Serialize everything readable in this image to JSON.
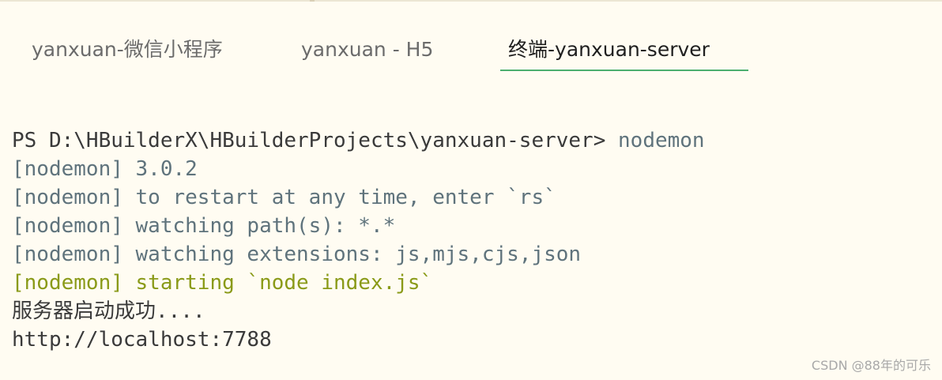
{
  "tabs": [
    {
      "label": "yanxuan-微信小程序",
      "active": false
    },
    {
      "label": "yanxuan - H5",
      "active": false
    },
    {
      "label": "终端-yanxuan-server",
      "active": true
    }
  ],
  "terminal": {
    "prompt": "PS D:\\HBuilderX\\HBuilderProjects\\yanxuan-server> ",
    "command": "nodemon",
    "lines": [
      "[nodemon] 3.0.2",
      "[nodemon] to restart at any time, enter `rs`",
      "[nodemon] watching path(s): *.*",
      "[nodemon] watching extensions: js,mjs,cjs,json",
      "[nodemon] starting `node index.js`",
      "服务器启动成功....",
      "http://localhost:7788"
    ]
  },
  "watermark": "CSDN @88年的可乐",
  "colors": {
    "background": "#fffcf2",
    "active_tab_underline": "#4caf6f",
    "nodemon_info": "#5f737c",
    "nodemon_starting": "#8a9a18",
    "plain_output": "#3a3a3a"
  }
}
